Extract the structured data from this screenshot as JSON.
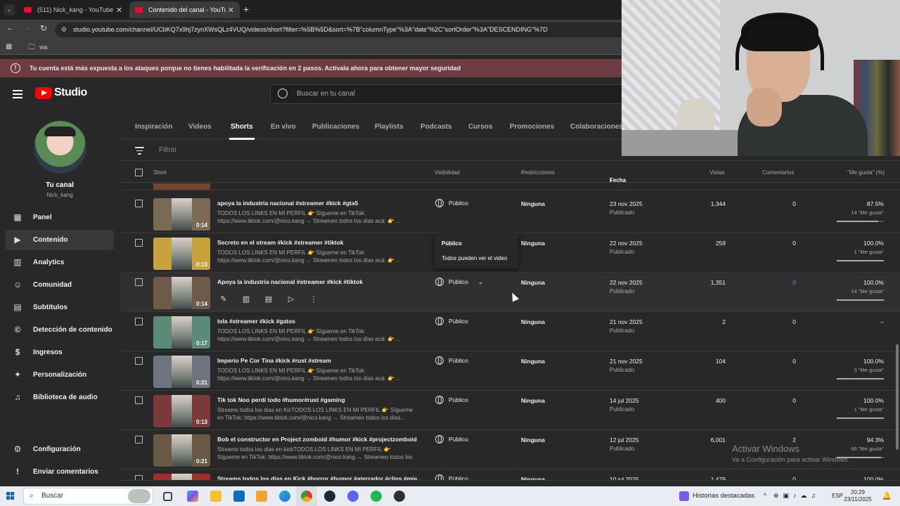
{
  "browser": {
    "tabs": [
      {
        "label": "(511) Nick_kang - YouTube",
        "active": false
      },
      {
        "label": "Contenido del canal - YouTube",
        "active": true
      }
    ],
    "new_tab_symbol": "+",
    "url": "studio.youtube.com/channel/UCbKQ7x9hj7zynXWsQLz4VUQ/videos/short?filter=%5B%5D&sort=%7B\"columnType\"%3A\"date\"%2C\"sortOrder\"%3A\"DESCENDING\"%7D",
    "bookmark_folder": "wa"
  },
  "warning_banner": "Tu cuenta está más expuesta a los ataques porque no tienes habilitada la verificación en 2 pasos. Actívala ahora para obtener mayor seguridad",
  "header": {
    "logo_text": "Studio",
    "search_placeholder": "Buscar en tu canal"
  },
  "channel": {
    "name": "Tu canal",
    "handle": "Nick_kang"
  },
  "sidebar": {
    "items": [
      {
        "label": "Panel",
        "icon": "dashboard-icon"
      },
      {
        "label": "Contenido",
        "icon": "content-icon",
        "active": true
      },
      {
        "label": "Analytics",
        "icon": "analytics-icon"
      },
      {
        "label": "Comunidad",
        "icon": "community-icon"
      },
      {
        "label": "Subtítulos",
        "icon": "subtitles-icon"
      },
      {
        "label": "Detección de contenido",
        "icon": "copyright-icon"
      },
      {
        "label": "Ingresos",
        "icon": "dollar-icon"
      },
      {
        "label": "Personalización",
        "icon": "magic-wand-icon"
      },
      {
        "label": "Biblioteca de audio",
        "icon": "audio-library-icon"
      }
    ],
    "bottom_items": [
      {
        "label": "Configuración",
        "icon": "gear-icon"
      },
      {
        "label": "Enviar comentarios",
        "icon": "feedback-icon"
      }
    ]
  },
  "content_tabs": [
    "Inspiración",
    "Videos",
    "Shorts",
    "En vivo",
    "Publicaciones",
    "Playlists",
    "Podcasts",
    "Cursos",
    "Promociones",
    "Colaboraciones"
  ],
  "active_tab": "Shorts",
  "filter_placeholder": "Filtrar",
  "columns": {
    "short": "Short",
    "visibility": "Visibilidad",
    "restrictions": "Restricciones",
    "date": "Fecha",
    "views": "Vistas",
    "comments": "Comentarios",
    "likes": "\"Me gusta\" (%)"
  },
  "rows": [
    {
      "title": "apoya la industria nacional #streamer #kick #gta5",
      "desc": "TODOS LOS LINKS EN MI PERFIL 👉 Sígueme en TikTok: https://www.tiktok.com/@nico.kang → Streameo todos los días acá: 👉 ...",
      "duration": "0:14",
      "visibility": "Público",
      "restrictions": "Ninguna",
      "date": "23 nov 2025",
      "status": "Publicado",
      "views": "1,344",
      "comments": "0",
      "likes": "87.5%",
      "likes_count": "14 \"Me gusta\"",
      "like_ratio": 0.875
    },
    {
      "title": "Secreto en el stream #kick #streamer #tiktok",
      "desc": "TODOS LOS LINKS EN MI PERFIL 👉 Sígueme en TikTok: https://www.tiktok.com/@nico.kang → Streameo todos los días acá: 👉 ...",
      "duration": "0:13",
      "visibility": "",
      "restrictions": "Ninguna",
      "date": "22 nov 2025",
      "status": "Publicado",
      "views": "259",
      "comments": "0",
      "likes": "100.0%",
      "likes_count": "1 \"Me gusta\"",
      "like_ratio": 1.0
    },
    {
      "title": "Apoya la industria nacional #streamer #kick #tiktok",
      "desc": "",
      "duration": "0:14",
      "visibility": "Público",
      "restrictions": "Ninguna",
      "date": "22 nov 2025",
      "status": "Publicado",
      "views": "1,351",
      "comments": "0",
      "likes": "100.0%",
      "likes_count": "14 \"Me gusta\"",
      "like_ratio": 1.0
    },
    {
      "title": "lola #streamer #kick #gatos",
      "desc": "TODOS LOS LINKS EN MI PERFIL 👉 Sígueme en TikTok: https://www.tiktok.com/@nico.kang → Streameo todos los días acá: 👉 ...",
      "duration": "0:17",
      "visibility": "Público",
      "restrictions": "Ninguna",
      "date": "21 nov 2025",
      "status": "Publicado",
      "views": "2",
      "comments": "0",
      "likes": "–",
      "likes_count": "",
      "like_ratio": null
    },
    {
      "title": "Imperio Pe Cor Tina #kick #rust #stream",
      "desc": "TODOS LOS LINKS EN MI PERFIL 👉 Sígueme en TikTok: https://www.tiktok.com/@nico.kang → Streameo todos los días acá: 👉 ...",
      "duration": "0:21",
      "visibility": "Público",
      "restrictions": "Ninguna",
      "date": "21 nov 2025",
      "status": "Publicado",
      "views": "104",
      "comments": "0",
      "likes": "100.0%",
      "likes_count": "3 \"Me gusta\"",
      "like_ratio": 1.0
    },
    {
      "title": "Tik tok Noo perdi todo #humor#rust #gaming",
      "desc": "Streams todos los dias en KicTODOS LOS LINKS EN MI PERFIL 👉 Sígueme en TikTok: https://www.tiktok.com/@nico.kang → Streameo todos los días...",
      "duration": "0:13",
      "visibility": "Público",
      "restrictions": "Ninguna",
      "date": "14 jul 2025",
      "status": "Publicado",
      "views": "400",
      "comments": "0",
      "likes": "100.0%",
      "likes_count": "1 \"Me gusta\"",
      "like_ratio": 1.0
    },
    {
      "title": "Bob el constructor en Project zomboid #humor #kick #projectzomboid",
      "desc": "Streams todos los dias en kickTODOS LOS LINKS EN MI PERFIL 👉 Sígueme en TikTok: https://www.tiktok.com/@nico.kang → Streameo todos los días...",
      "duration": "0:21",
      "visibility": "Público",
      "restrictions": "Ninguna",
      "date": "12 jul 2025",
      "status": "Publicado",
      "views": "6,001",
      "comments": "2",
      "likes": "94.3%",
      "likes_count": "66 \"Me gusta\"",
      "like_ratio": 0.943
    },
    {
      "title": "Streams todos los dias en Kick #horror #humor #aterrador #clips #mie...",
      "desc": "",
      "duration": "",
      "visibility": "Público",
      "restrictions": "Ninguna",
      "date": "10 jul 2025",
      "status": "",
      "views": "1,479",
      "comments": "0",
      "likes": "100.0%",
      "likes_count": "",
      "like_ratio": null
    }
  ],
  "tooltip": {
    "title": "Público",
    "text": "Todos pueden ver el video"
  },
  "activate_windows": {
    "title": "Activar Windows",
    "subtitle": "Ve a Configuración para activar Windows."
  },
  "taskbar": {
    "search_label": "Buscar",
    "widgets_label": "Historias destacadas",
    "language": "ESP",
    "time": "20:29",
    "date": "23/11/2025"
  }
}
